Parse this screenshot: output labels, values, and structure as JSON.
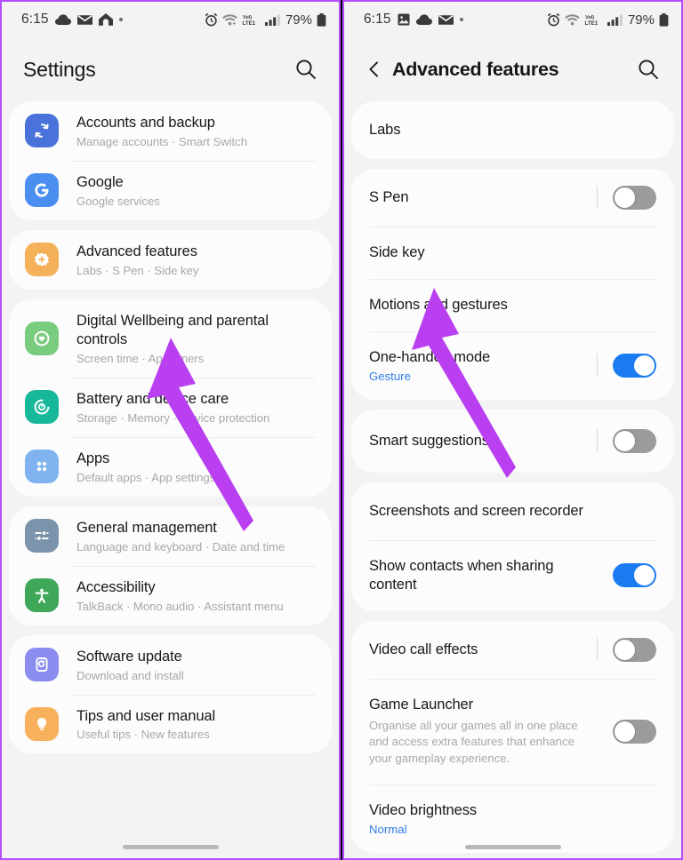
{
  "statusbar_left": {
    "time": "6:15",
    "icons": [
      "cloud-icon",
      "mail-icon",
      "home-icon",
      "dot-icon"
    ]
  },
  "statusbar_right": {
    "time": "6:15",
    "icons": [
      "image-icon",
      "cloud-icon",
      "mail-icon",
      "dot-icon"
    ]
  },
  "statusbar_common": {
    "alarm": "alarm-icon",
    "wifi": "wifi-icon",
    "volte": "VoLTE",
    "volte_top": "VoI)",
    "volte_bottom": "LTE1",
    "signal": "signal-bars-icon",
    "battery_pct": "79%",
    "battery": "battery-icon"
  },
  "left_screen": {
    "title": "Settings",
    "search_icon": "search-icon",
    "groups": [
      {
        "rows": [
          {
            "title": "Accounts and backup",
            "subtitle": "Manage accounts  ·  Smart Switch",
            "icon": "sync-icon",
            "icon_color": "#4a72db"
          },
          {
            "title": "Google",
            "subtitle": "Google services",
            "icon": "google-g-icon",
            "icon_color": "#4a8ef0"
          }
        ]
      },
      {
        "rows": [
          {
            "title": "Advanced features",
            "subtitle": "Labs  ·  S Pen  ·  Side key",
            "icon": "gear-plus-icon",
            "icon_color": "#f5b05a"
          }
        ]
      },
      {
        "rows": [
          {
            "title": "Digital Wellbeing and parental controls",
            "subtitle": "Screen time  ·  App timers",
            "icon": "heart-circle-icon",
            "icon_color": "#79cc7e"
          },
          {
            "title": "Battery and device care",
            "subtitle": "Storage  ·  Memory  ·  Device protection",
            "icon": "battery-care-icon",
            "icon_color": "#17b89a"
          },
          {
            "title": "Apps",
            "subtitle": "Default apps  ·  App settings",
            "icon": "apps-grid-icon",
            "icon_color": "#7eb3ef"
          }
        ]
      },
      {
        "rows": [
          {
            "title": "General management",
            "subtitle": "Language and keyboard  ·  Date and time",
            "icon": "sliders-icon",
            "icon_color": "#7b93ab"
          },
          {
            "title": "Accessibility",
            "subtitle": "TalkBack  ·  Mono audio  ·  Assistant menu",
            "icon": "accessibility-icon",
            "icon_color": "#3fa758"
          }
        ]
      },
      {
        "rows": [
          {
            "title": "Software update",
            "subtitle": "Download and install",
            "icon": "software-update-icon",
            "icon_color": "#8a8cf0"
          },
          {
            "title": "Tips and user manual",
            "subtitle": "Useful tips  ·  New features",
            "icon": "lightbulb-icon",
            "icon_color": "#f7b15c"
          }
        ]
      }
    ]
  },
  "right_screen": {
    "title": "Advanced features",
    "back_icon": "chevron-left-icon",
    "search_icon": "search-icon",
    "groups": [
      {
        "rows": [
          {
            "title": "Labs",
            "toggle": null
          }
        ]
      },
      {
        "rows": [
          {
            "title": "S Pen",
            "toggle": "off"
          },
          {
            "title": "Side key",
            "toggle": null
          },
          {
            "title": "Motions and gestures",
            "toggle": null
          },
          {
            "title": "One-handed mode",
            "subtitle_blue": "Gesture",
            "toggle": "on"
          }
        ]
      },
      {
        "rows": [
          {
            "title": "Smart suggestions",
            "toggle": "off"
          }
        ]
      },
      {
        "rows": [
          {
            "title": "Screenshots and screen recorder",
            "toggle": null
          },
          {
            "title": "Show contacts when sharing content",
            "toggle": "on"
          }
        ]
      },
      {
        "rows": [
          {
            "title": "Video call effects",
            "toggle": "off"
          },
          {
            "title": "Game Launcher",
            "description": "Organise all your games all in one place and access extra features that enhance your gameplay experience.",
            "toggle": "off"
          },
          {
            "title": "Video brightness",
            "subtitle_blue": "Normal",
            "toggle": null
          }
        ]
      }
    ]
  },
  "annotations": {
    "left_arrow": "purple-arrow-pointing-to-advanced-features",
    "right_arrow": "purple-arrow-pointing-to-side-key",
    "arrow_color": "#b93ff0"
  },
  "colors": {
    "accent_purple": "#b44dff",
    "toggle_on": "#1a7cf0",
    "toggle_off": "#9b9b9b",
    "card_bg": "#fcfcfc",
    "page_bg": "#f3f3f3",
    "link_blue": "#2e7ce4"
  }
}
